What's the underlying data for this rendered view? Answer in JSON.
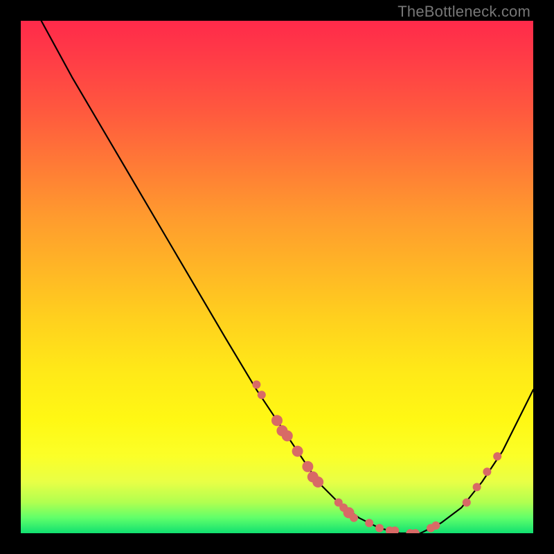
{
  "watermark": "TheBottleneck.com",
  "chart_data": {
    "type": "line",
    "title": "",
    "xlabel": "",
    "ylabel": "",
    "xlim": [
      0,
      100
    ],
    "ylim": [
      0,
      100
    ],
    "grid": false,
    "legend": false,
    "series": [
      {
        "name": "bottleneck-curve",
        "x": [
          0,
          4,
          10,
          20,
          30,
          40,
          46,
          50,
          54,
          58,
          62,
          66,
          70,
          74,
          78,
          82,
          86,
          90,
          94,
          100
        ],
        "y": [
          112,
          100,
          89,
          72,
          55,
          38,
          28,
          22,
          16,
          10,
          6,
          3,
          1,
          0,
          0,
          2,
          5,
          10,
          16,
          28
        ],
        "color": "#000000",
        "marker": false
      }
    ],
    "points": {
      "name": "highlight-points",
      "color": "#d86a66",
      "radius_small": 6,
      "radius_large": 8,
      "coords": [
        {
          "x": 46,
          "y": 29,
          "r": 6
        },
        {
          "x": 47,
          "y": 27,
          "r": 6
        },
        {
          "x": 50,
          "y": 22,
          "r": 8
        },
        {
          "x": 51,
          "y": 20,
          "r": 8
        },
        {
          "x": 52,
          "y": 19,
          "r": 8
        },
        {
          "x": 54,
          "y": 16,
          "r": 8
        },
        {
          "x": 56,
          "y": 13,
          "r": 8
        },
        {
          "x": 57,
          "y": 11,
          "r": 8
        },
        {
          "x": 58,
          "y": 10,
          "r": 8
        },
        {
          "x": 62,
          "y": 6,
          "r": 6
        },
        {
          "x": 63,
          "y": 5,
          "r": 6
        },
        {
          "x": 64,
          "y": 4,
          "r": 8
        },
        {
          "x": 65,
          "y": 3,
          "r": 6
        },
        {
          "x": 68,
          "y": 2,
          "r": 6
        },
        {
          "x": 70,
          "y": 1,
          "r": 6
        },
        {
          "x": 72,
          "y": 0.5,
          "r": 6
        },
        {
          "x": 73,
          "y": 0.5,
          "r": 6
        },
        {
          "x": 76,
          "y": 0,
          "r": 6
        },
        {
          "x": 77,
          "y": 0,
          "r": 6
        },
        {
          "x": 80,
          "y": 1,
          "r": 6
        },
        {
          "x": 81,
          "y": 1.5,
          "r": 6
        },
        {
          "x": 87,
          "y": 6,
          "r": 6
        },
        {
          "x": 89,
          "y": 9,
          "r": 6
        },
        {
          "x": 91,
          "y": 12,
          "r": 6
        },
        {
          "x": 93,
          "y": 15,
          "r": 6
        }
      ]
    }
  }
}
